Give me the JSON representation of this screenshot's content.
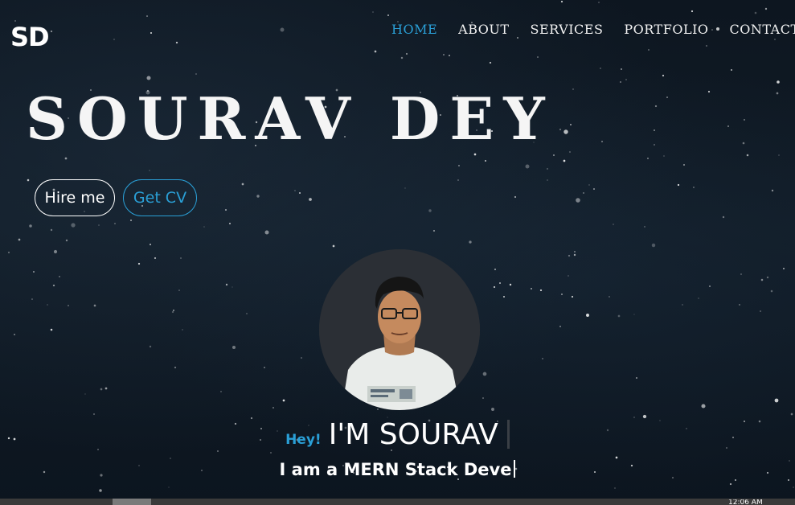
{
  "header": {
    "logo_text": "SD",
    "nav": [
      {
        "label": "HOME",
        "active": true
      },
      {
        "label": "ABOUT",
        "active": false
      },
      {
        "label": "SERVICES",
        "active": false
      },
      {
        "label": "PORTFOLIO",
        "active": false
      },
      {
        "label": "CONTACT",
        "active": false
      }
    ]
  },
  "hero": {
    "title": "SOURAV DEY",
    "hire_label": "Hire me",
    "cv_label": "Get CV",
    "greeting": "Hey!",
    "name": "I'M SOURAV",
    "subtitle": "I am a MERN Stack Deve"
  },
  "taskbar": {
    "clock": "12:06 AM"
  },
  "colors": {
    "accent": "#2a9fd6",
    "text": "#ffffff",
    "background": "#0d1620"
  }
}
